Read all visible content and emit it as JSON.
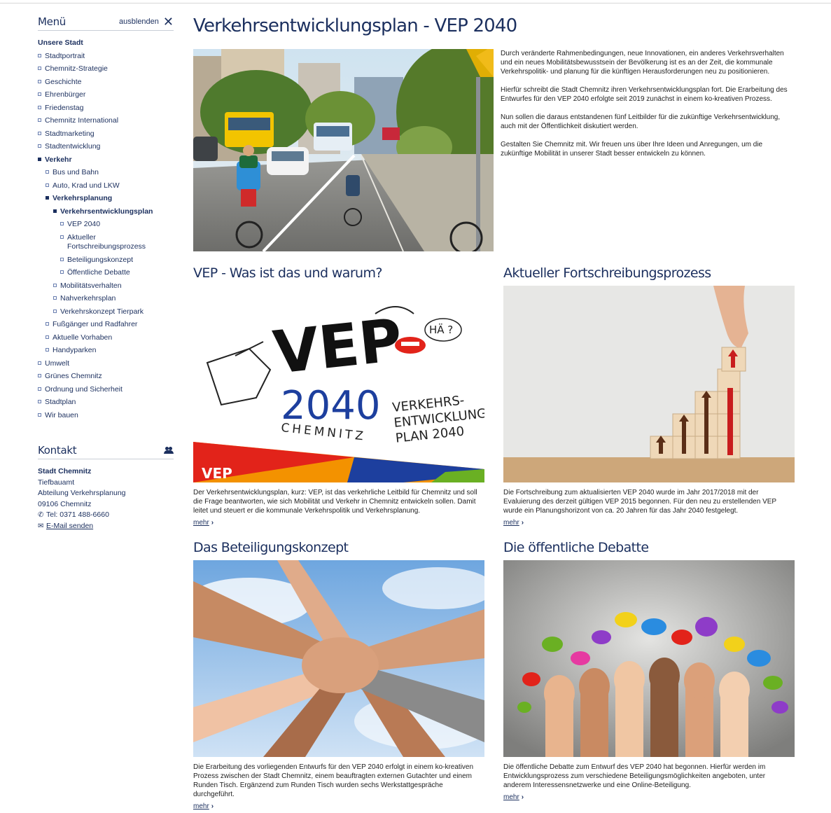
{
  "sidebar": {
    "menu_title": "Menü",
    "hide_label": "ausblenden",
    "items": [
      {
        "label": "Unsere Stadt",
        "level": "head"
      },
      {
        "label": "Stadtportrait",
        "level": "l1"
      },
      {
        "label": "Chemnitz-Strategie",
        "level": "l1"
      },
      {
        "label": "Geschichte",
        "level": "l1"
      },
      {
        "label": "Ehrenbürger",
        "level": "l1"
      },
      {
        "label": "Friedenstag",
        "level": "l1"
      },
      {
        "label": "Chemnitz International",
        "level": "l1"
      },
      {
        "label": "Stadtmarketing",
        "level": "l1"
      },
      {
        "label": "Stadtentwicklung",
        "level": "l1"
      },
      {
        "label": "Verkehr",
        "level": "l1",
        "active": true
      },
      {
        "label": "Bus und Bahn",
        "level": "l2"
      },
      {
        "label": "Auto, Krad und LKW",
        "level": "l2"
      },
      {
        "label": "Verkehrsplanung",
        "level": "l2",
        "active": true
      },
      {
        "label": "Verkehrsentwicklungsplan",
        "level": "l3",
        "active": true
      },
      {
        "label": "VEP 2040",
        "level": "l4"
      },
      {
        "label": "Aktueller Fortschreibungsprozess",
        "level": "l4"
      },
      {
        "label": "Beteiligungskonzept",
        "level": "l4"
      },
      {
        "label": "Öffentliche Debatte",
        "level": "l4"
      },
      {
        "label": "Mobilitätsverhalten",
        "level": "l3"
      },
      {
        "label": "Nahverkehrsplan",
        "level": "l3"
      },
      {
        "label": "Verkehrskonzept Tierpark",
        "level": "l3"
      },
      {
        "label": "Fußgänger und Radfahrer",
        "level": "l2"
      },
      {
        "label": "Aktuelle Vorhaben",
        "level": "l2"
      },
      {
        "label": "Handyparken",
        "level": "l2"
      },
      {
        "label": "Umwelt",
        "level": "l1"
      },
      {
        "label": "Grünes Chemnitz",
        "level": "l1"
      },
      {
        "label": "Ordnung und Sicherheit",
        "level": "l1"
      },
      {
        "label": "Stadtplan",
        "level": "l1"
      },
      {
        "label": "Wir bauen",
        "level": "l1"
      }
    ],
    "kontakt": {
      "title": "Kontakt",
      "org": "Stadt Chemnitz",
      "dept1": "Tiefbauamt",
      "dept2": "Abteilung Verkehrsplanung",
      "city": "09106 Chemnitz",
      "phone": "Tel: 0371 488-6660",
      "email": "E-Mail senden"
    }
  },
  "main": {
    "title": "Verkehrsentwicklungsplan - VEP 2040",
    "intro": [
      "Durch veränderte Rahmenbedingungen, neue Innovationen, ein anderes Verkehrsverhalten und ein neues Mobilitätsbewusstsein der Bevölkerung ist es an der Zeit, die kommunale Verkehrspolitik- und planung für die künftigen Herausforderungen neu zu positionieren.",
      "Hierfür schreibt die Stadt Chemnitz ihren Verkehrsentwicklungsplan fort. Die Erarbeitung des Entwurfes für den VEP 2040 erfolgte seit 2019 zunächst in einem ko-kreativen Prozess.",
      "Nun sollen die daraus entstandenen fünf Leitbilder für die zukünftige Verkehrsentwicklung, auch mit der Öffentlichkeit diskutiert werden.",
      "Gestalten Sie Chemnitz mit. Wir freuen uns über Ihre Ideen und Anregungen, um die zukünftige Mobilität in unserer Stadt besser entwickeln zu können."
    ],
    "cards": [
      {
        "title": "VEP - Was ist das und warum?",
        "text": "Der Verkehrsentwicklungsplan, kurz: VEP, ist das verkehrliche Leitbild für Chemnitz und soll die Frage beantworten, wie sich Mobilität und Verkehr in Chemnitz entwickeln sollen. Damit leitet und steuert er die kommunale Verkehrspolitik und Verkehrsplanung.",
        "more": "mehr"
      },
      {
        "title": "Aktueller Fortschreibungsprozess",
        "text": "Die Fortschreibung zum aktualisierten VEP 2040 wurde im Jahr 2017/2018 mit der Evaluierung des derzeit gültigen VEP 2015 begonnen. Für den neu zu erstellenden VEP wurde ein Planungshorizont von ca. 20 Jahren für das Jahr 2040 festgelegt.",
        "more": "mehr"
      },
      {
        "title": "Das Beteiligungskonzept",
        "text": "Die Erarbeitung des vorliegenden Entwurfs für den VEP 2040 erfolgt in einem ko-kreativen Prozess zwischen der Stadt Chemnitz, einem beauftragten externen Gutachter und einem Runden Tisch. Ergänzend zum Runden Tisch wurden sechs Werkstattgespräche durchgeführt.",
        "more": "mehr"
      },
      {
        "title": "Die öffentliche Debatte",
        "text": "Die öffentliche Debatte zum Entwurf des VEP 2040 hat begonnen. Hierfür werden im Entwicklungsprozess zum verschiedene Beteiligungsmöglichkeiten angeboten, unter anderem Interessensnetzwerke und eine Online-Beteiligung.",
        "more": "mehr"
      }
    ],
    "logo": {
      "vep": "VEP",
      "year": "2040",
      "city": "CHEMNITZ",
      "line1": "VERKEHRS-",
      "line2": "ENTWICKLUNGS",
      "line3": "PLAN 2040",
      "bubble": "HÄ ?",
      "badge": "VEP"
    },
    "colors": {
      "brand_navy": "#1b2f5e",
      "accent_red": "#e2231a",
      "logo_blue": "#1d3f9e",
      "logo_orange": "#f39200",
      "logo_green": "#6ab023"
    }
  }
}
